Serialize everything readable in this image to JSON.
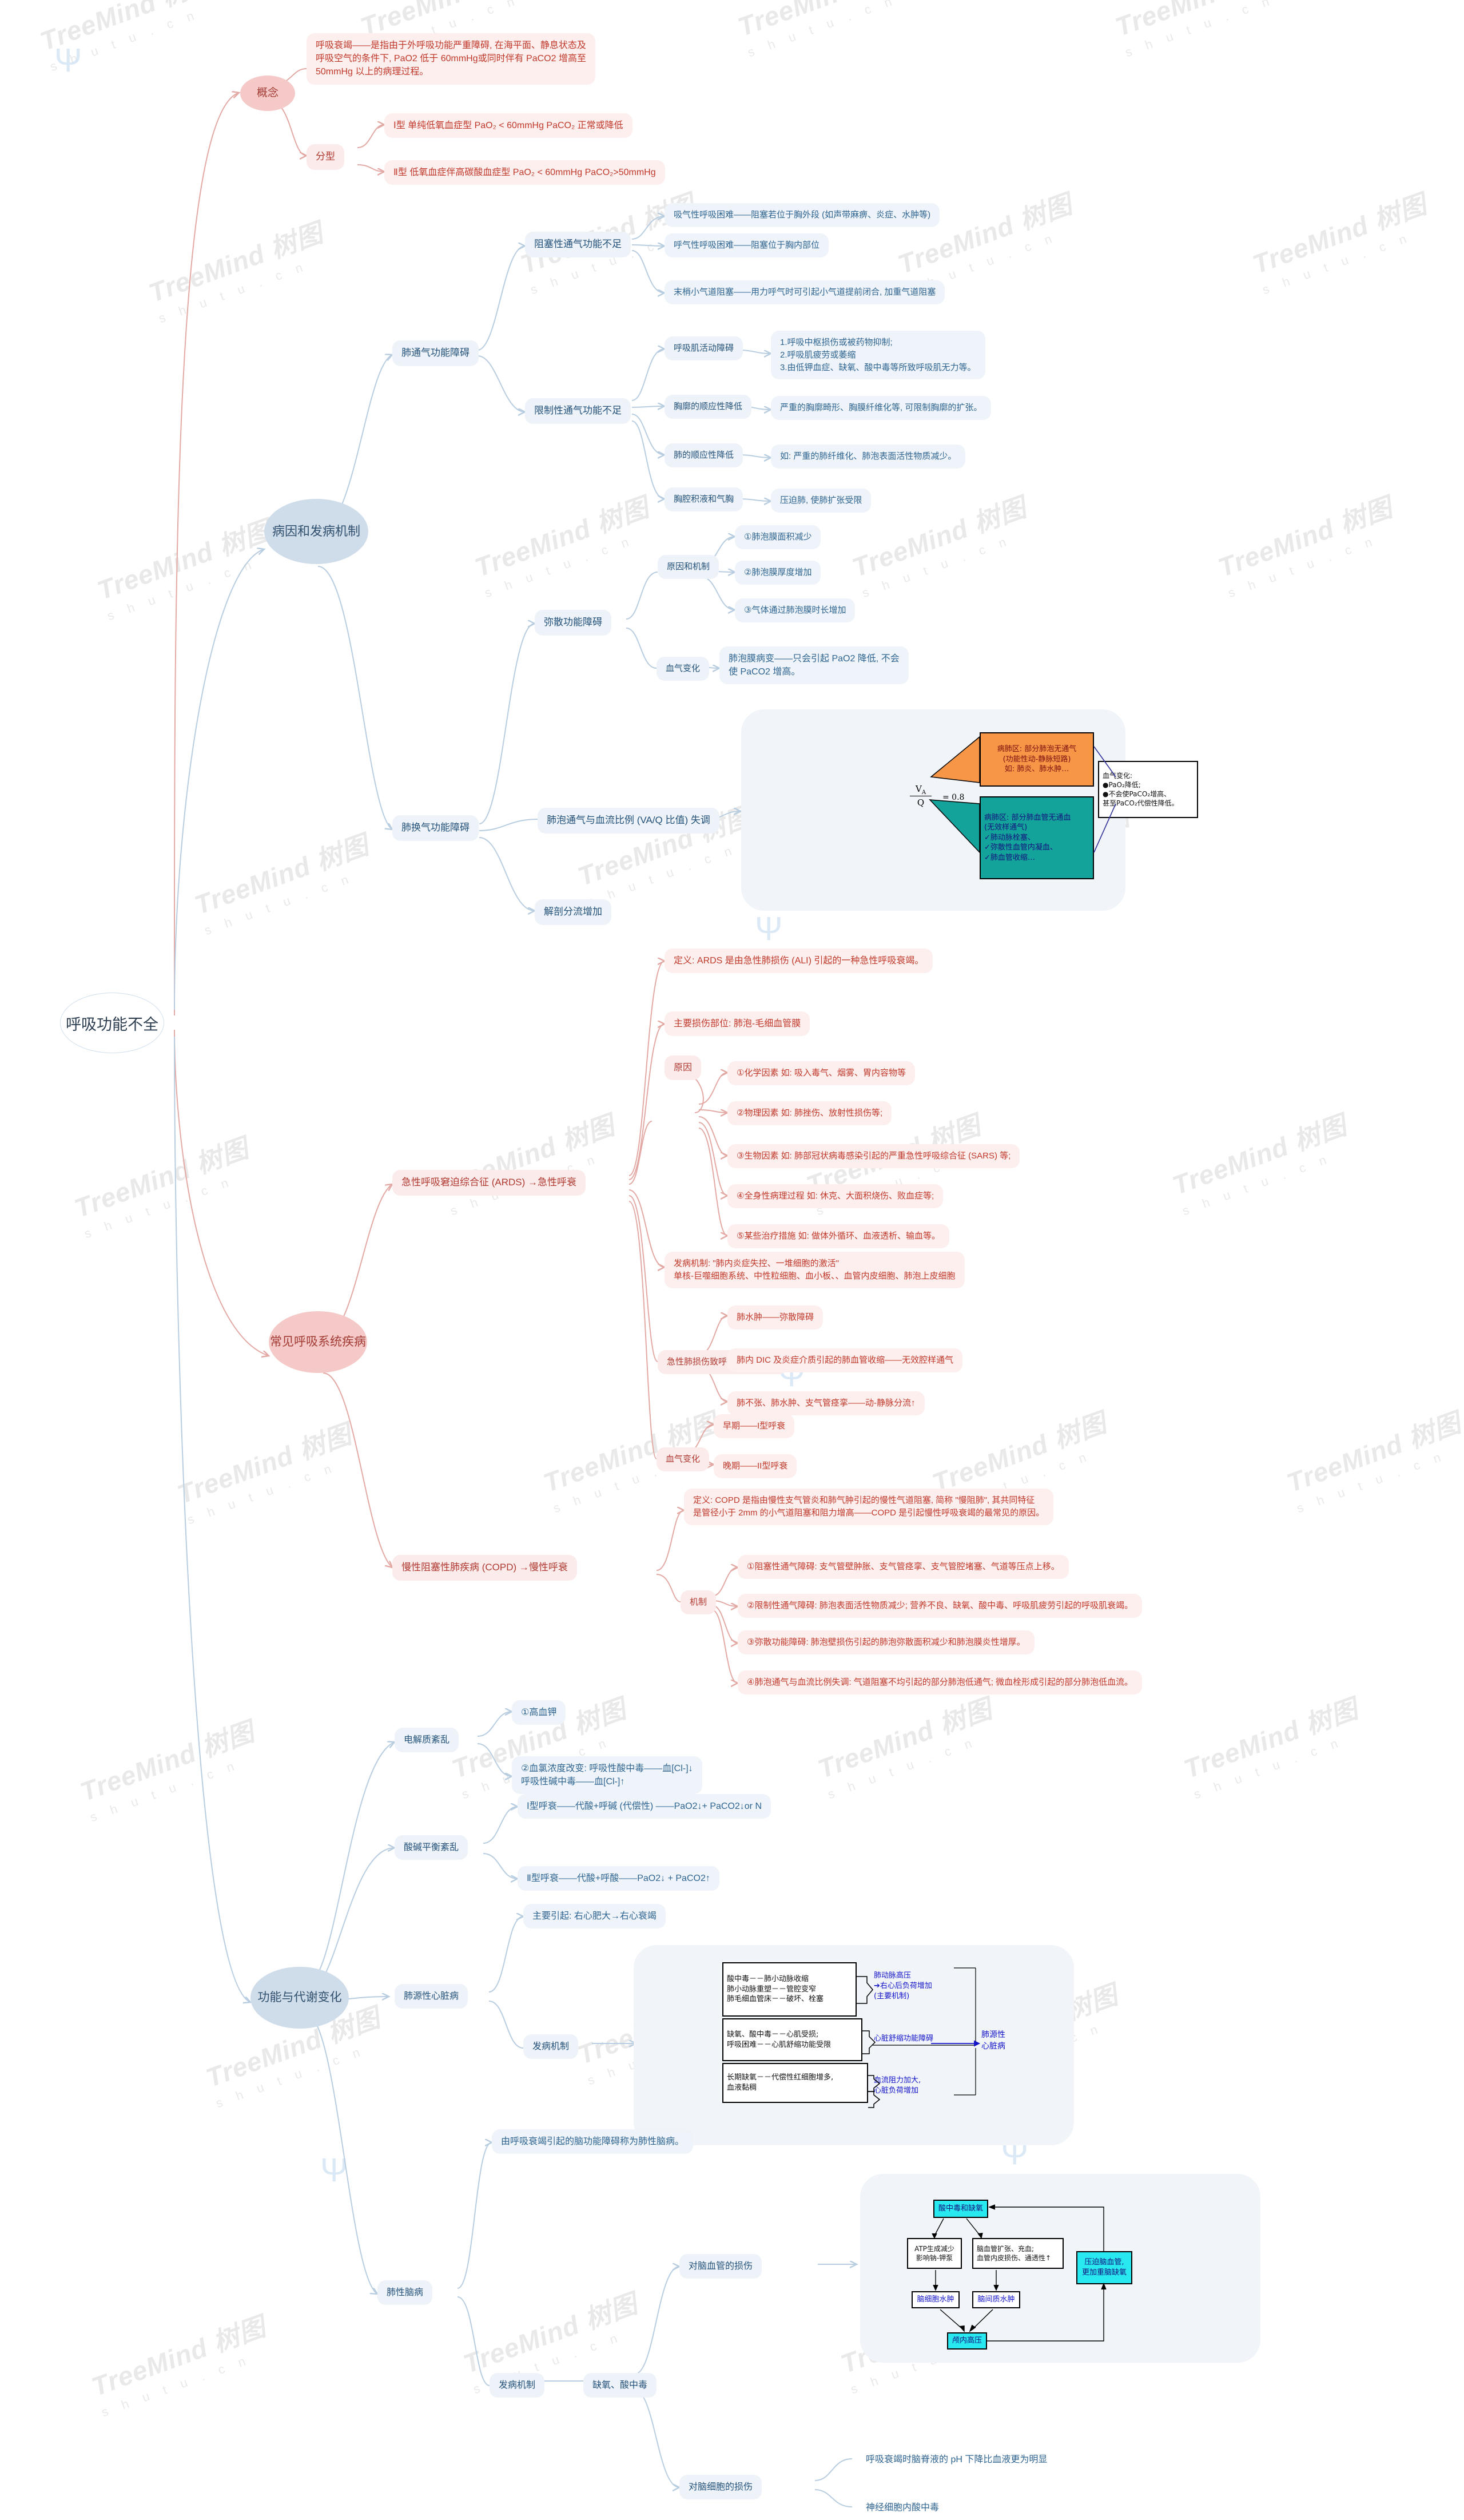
{
  "meta": {
    "root_title": "呼吸功能不全",
    "watermark_line1": "TreeMind 树图",
    "watermark_line2": "s h u t u . c n",
    "watermark_alt1": "TreeMind shutu.cn",
    "colors": {
      "red_branch": "#c0392b",
      "blue_branch": "#2f6490",
      "root_border": "#cfe0ef",
      "orange_box": "#f79646",
      "teal_box": "#14a39a",
      "cyan_box": "#28e8f0"
    }
  },
  "branches": {
    "gainian": {
      "label": "概念",
      "definition": "呼吸衰竭——是指由于外呼吸功能严重障碍, 在海平面、静息状态及\n呼吸空气的条件下, PaO2 低于 60mmHg或同时伴有 PaCO2 增高至\n50mmHg 以上的病理过程。",
      "fenxing_label": "分型",
      "type1": "Ⅰ型 单纯低氧血症型  PaO₂ < 60mmHg  PaCO₂ 正常或降低",
      "type2": "Ⅱ型 低氧血症伴高碳酸血症型  PaO₂ < 60mmHg  PaCO₂>50mmHg"
    },
    "bingyin": {
      "label": "病因和发病机制",
      "tongqi": {
        "label": "肺通气功能障碍",
        "zusai": {
          "label": "阻塞性通气功能不足",
          "items": [
            "吸气性呼吸困难——阻塞若位于胸外段 (如声带麻痹、炎症、水肿等)",
            "呼气性呼吸困难——阻塞位于胸内部位",
            "末梢小气道阻塞——用力呼气时可引起小气道提前闭合, 加重气道阻塞"
          ]
        },
        "xianzhi": {
          "label": "限制性通气功能不足",
          "items": [
            {
              "title": "呼吸肌活动障碍",
              "detail": "1.呼吸中枢损伤或被药物抑制;\n2.呼吸肌疲劳或萎缩\n3.由低钾血症、缺氧、酸中毒等所致呼吸肌无力等。"
            },
            {
              "title": "胸廓的顺应性降低",
              "detail": "严重的胸廓畸形、胸膜纤维化等, 可限制胸廓的扩张。"
            },
            {
              "title": "肺的顺应性降低",
              "detail": "如: 严重的肺纤维化、肺泡表面活性物质减少。"
            },
            {
              "title": "胸腔积液和气胸",
              "detail": "压迫肺, 使肺扩张受限"
            }
          ]
        }
      },
      "huanqi": {
        "label": "肺换气功能障碍",
        "misan": {
          "label": "弥散功能障碍",
          "yuanyin_label": "原因和机制",
          "yuanyin_items": [
            "①肺泡膜面积减少",
            "②肺泡膜厚度增加",
            "③气体通过肺泡膜时长增加"
          ],
          "xueqi_label": "血气变化",
          "xueqi_detail": "肺泡膜病变——只会引起 PaO2 降低, 不会\n使 PaCO2 增高。"
        },
        "vaq_label": "肺泡通气与血流比例 (VA/Q 比值) 失调",
        "vaq_figure": {
          "ratio_numerator": "V",
          "ratio_numerator_sub": "A",
          "ratio_denominator": "Q",
          "ratio_value": "= 0.8",
          "orange_box": "病肺区: 部分肺泡无通气\n(功能性动-静脉短路)\n如: 肺炎、肺水肿…",
          "teal_box": "病肺区: 部分肺血管无通血\n(无效样通气)\n✓肺动脉栓塞、\n✓弥散性血管内凝血、\n✓肺血管收缩…",
          "white_box": "血气变化:\n●PaO₂降低;\n●不会使PaCO₂增高、\n甚至PaCO₂代偿性降低。"
        },
        "jiepou_label": "解剖分流增加"
      }
    },
    "changjian": {
      "label": "常见呼吸系统疾病",
      "ards": {
        "label": "急性呼吸窘迫综合征 (ARDS) →急性呼衰",
        "definition": "定义: ARDS 是由急性肺损伤 (ALI) 引起的一种急性呼吸衰竭。",
        "site": "主要损伤部位: 肺泡-毛细血管膜",
        "yuanyin_label": "原因",
        "yuanyin_items": [
          "①化学因素 如: 吸入毒气、烟雾、胃内容物等",
          "②物理因素 如: 肺挫伤、放射性损伤等;",
          "③生物因素 如: 肺部冠状病毒感染引起的严重急性呼吸综合征 (SARS) 等;",
          "④全身性病理过程 如: 休克、大面积烧伤、败血症等;",
          "⑤某些治疗措施 如: 做体外循环、血液透析、输血等。"
        ],
        "fabing": "发病机制: \"肺内炎症失控、一堆细胞的激活\"\n单核-巨噬细胞系统、中性粒细胞、血小板、、血管内皮细胞、肺泡上皮细胞",
        "jizhi_label": "急性肺损伤致呼吸衰竭的机制",
        "jizhi_items": [
          "肺水肿——弥散障碍",
          "肺内 DIC 及炎症介质引起的肺血管收缩——无效腔样通气",
          "肺不张、肺水肿、支气管痉挛——动-静脉分流↑"
        ],
        "xueqi_label": "血气变化",
        "xueqi_items": [
          "早期——I型呼衰",
          "晚期——II型呼衰"
        ]
      },
      "copd": {
        "label": "慢性阻塞性肺疾病 (COPD) →慢性呼衰",
        "definition": "定义: COPD 是指由慢性支气管炎和肺气肿引起的慢性气道阻塞, 简称 \"慢阻肺\", 其共同特征\n是管径小于 2mm 的小气道阻塞和阻力增高——COPD 是引起慢性呼吸衰竭的最常见的原因。",
        "jizhi_label": "机制",
        "jizhi_items": [
          "①阻塞性通气障碍: 支气管壁肿胀、支气管痉挛、支气管腔堵塞、气道等压点上移。",
          "②限制性通气障碍: 肺泡表面活性物质减少; 营养不良、缺氧、酸中毒、呼吸肌疲劳引起的呼吸肌衰竭。",
          "③弥散功能障碍: 肺泡壁损伤引起的肺泡弥散面积减少和肺泡膜炎性增厚。",
          "④肺泡通气与血流比例失调: 气道阻塞不均引起的部分肺泡低通气; 微血栓形成引起的部分肺泡低血流。"
        ]
      }
    },
    "gongneng": {
      "label": "功能与代谢变化",
      "dianjiezhi": {
        "label": "电解质紊乱",
        "items": [
          "①高血钾",
          "②血氯浓度改变: 呼吸性酸中毒——血[Cl-]↓\n                      呼吸性碱中毒——血[Cl-]↑"
        ]
      },
      "suanjian": {
        "label": "酸碱平衡紊乱",
        "items": [
          "Ⅰ型呼衰——代酸+呼碱 (代偿性) ——PaO2↓+ PaCO2↓or N",
          "Ⅱ型呼衰——代酸+呼酸——PaO2↓ + PaCO2↑"
        ]
      },
      "feixin": {
        "label": "肺源性心脏病",
        "zhuyao": "主要引起: 右心肥大→右心衰竭",
        "fabing_label": "发病机制",
        "figure": {
          "box1": "酸中毒－－肺小动脉收缩\n肺小动脉重塑－－管腔变窄\n肺毛细血管床－－破坏、栓塞",
          "box2": "缺氧、酸中毒－－心肌受损;\n呼吸困难－－心肌舒缩功能受限",
          "box3": "长期缺氧－－代偿性红细胞增多,\n血液黏稠",
          "out1": "肺动脉高压\n➔右心后负荷增加\n(主要机制)",
          "out2": "心脏舒缩功能障碍",
          "out3": "血流阻力加大,\n心脏负荷增加",
          "final": "肺源性\n心脏病"
        }
      },
      "feixingnaobing": {
        "label": "肺性脑病",
        "definition": "由呼吸衰竭引起的脑功能障碍称为肺性脑病。",
        "fabing_label": "发病机制",
        "quexiao_label": "缺氧、酸中毒",
        "naoxueguan_label": "对脑血管的损伤",
        "naoxibao_label": "对脑细胞的损伤",
        "naoxibao_items": [
          "呼吸衰竭时脑脊液的 pH 下降比血液更为明显",
          "神经细胞内酸中毒"
        ],
        "figure": {
          "top": "酸中毒和缺氧",
          "left": "ATP生成减少\n影响钠-钾泵",
          "right": "脑血管扩张、充血;\n血管内皮损伤、通透性↑",
          "left_out": "脑细胞水肿",
          "right_out": "脑间质水肿",
          "bottom": "颅内高压",
          "side": "压迫脑血管,\n更加重脑缺氧"
        }
      }
    }
  }
}
